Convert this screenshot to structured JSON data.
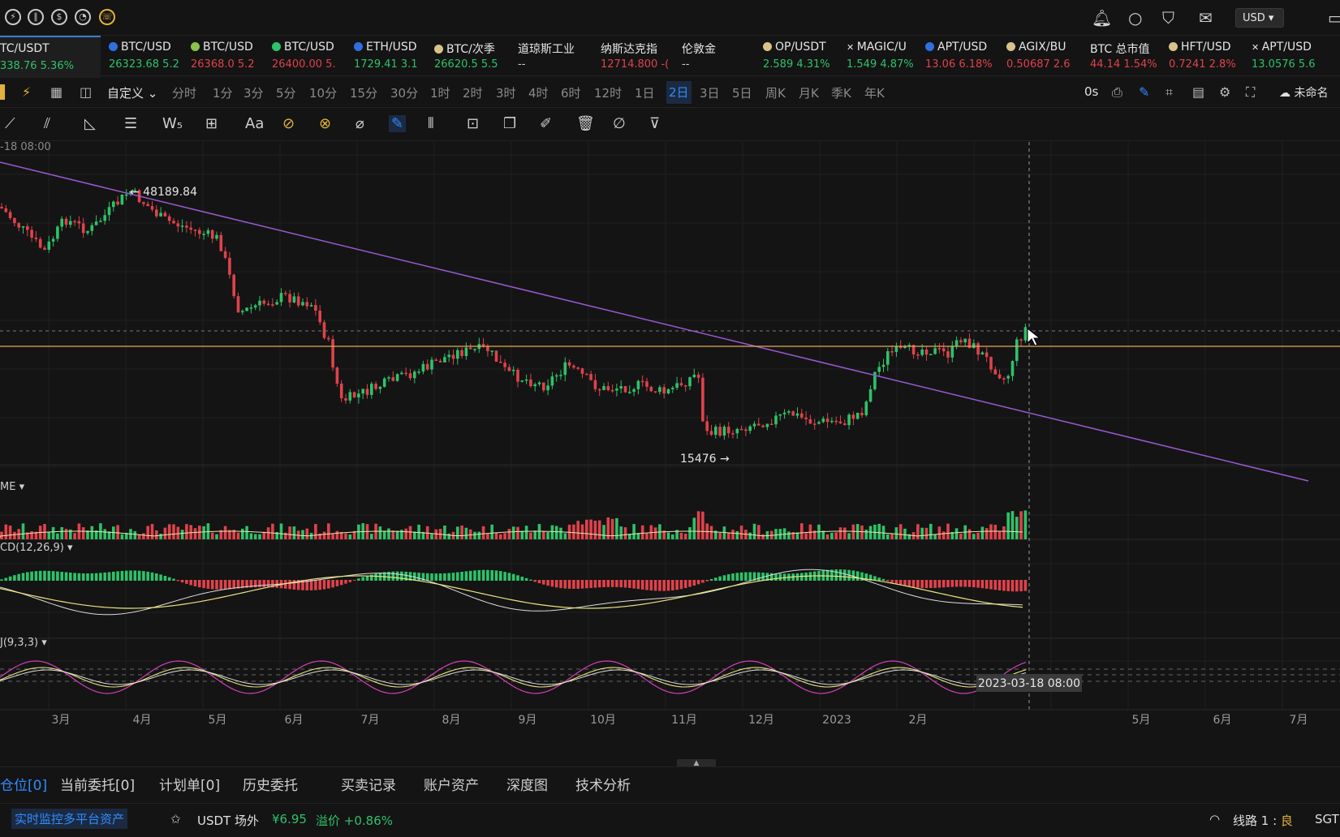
{
  "topbar": {
    "currency": "USD"
  },
  "tickers": [
    {
      "name": "TC/USDT",
      "value": "338.76",
      "change": "5.36%",
      "dot": "",
      "trend": "up",
      "active": true
    },
    {
      "name": "BTC/USD",
      "value": "26323.68",
      "change": "5.2",
      "dot": "#2f6fe0",
      "trend": "up"
    },
    {
      "name": "BTC/USD",
      "value": "26368.0",
      "change": "5.2",
      "dot": "#8bc34a",
      "trend": "dn"
    },
    {
      "name": "BTC/USD",
      "value": "26400.00",
      "change": "5.",
      "dot": "#2ec26a",
      "trend": "dn"
    },
    {
      "name": "ETH/USD",
      "value": "1729.41",
      "change": "3.1",
      "dot": "#2f6fe0",
      "trend": "up"
    },
    {
      "name": "BTC/次季",
      "value": "26620.5",
      "change": "5.5",
      "dot": "#d8c38a",
      "trend": "up"
    },
    {
      "name": "道琼斯工业",
      "value": "--",
      "change": "",
      "dot": "",
      "trend": "wt"
    },
    {
      "name": "纳斯达克指",
      "value": "12714.800",
      "change": "-(",
      "dot": "",
      "trend": "dn"
    },
    {
      "name": "伦敦金",
      "value": "--",
      "change": "",
      "dot": "",
      "trend": "wt"
    },
    {
      "name": "OP/USDT",
      "value": "2.589",
      "change": "4.31%",
      "dot": "#d8c38a",
      "trend": "up"
    },
    {
      "name": "MAGIC/U",
      "value": "1.549",
      "change": "4.87%",
      "dot": "",
      "trend": "up",
      "icon": "✕"
    },
    {
      "name": "APT/USD",
      "value": "13.06",
      "change": "6.18%",
      "dot": "#2f6fe0",
      "trend": "dn"
    },
    {
      "name": "AGIX/BU",
      "value": "0.50687",
      "change": "2.6",
      "dot": "#d8c38a",
      "trend": "dn"
    },
    {
      "name": "BTC 总市值",
      "value": "44.14",
      "change": "1.54%",
      "dot": "",
      "trend": "dn"
    },
    {
      "name": "HFT/USD",
      "value": "0.7241",
      "change": "2.8%",
      "dot": "#d8c38a",
      "trend": "dn"
    },
    {
      "name": "APT/USD",
      "value": "13.0576",
      "change": "5.6",
      "dot": "",
      "trend": "up",
      "icon": "✕"
    }
  ],
  "intervals": {
    "custom": "自定义",
    "items": [
      "分时",
      "1分",
      "3分",
      "5分",
      "10分",
      "15分",
      "30分",
      "1时",
      "2时",
      "3时",
      "4时",
      "6时",
      "12时",
      "1日",
      "2日",
      "3日",
      "5日",
      "周K",
      "月K",
      "季K",
      "年K"
    ],
    "selected": "2日",
    "countdown": "0s",
    "layout_name": "未命名"
  },
  "chart": {
    "crosshair_time_label": "-18 08:00",
    "high_label": "← 48189.84",
    "low_label": "15476 →",
    "volume_label": "ME",
    "macd_label": "CD(12,26,9)",
    "kdj_label": "J(9,3,3)",
    "x_axis": [
      "3月",
      "4月",
      "5月",
      "6月",
      "7月",
      "8月",
      "9月",
      "10月",
      "11月",
      "12月",
      "2023",
      "2月",
      "5月",
      "6月",
      "7月"
    ],
    "crosshair_date": "2023-03-18 08:00",
    "colors": {
      "up": "#2ec26a",
      "down": "#e0424b",
      "trendline": "#9b59d0",
      "hline": "#e5a65a"
    }
  },
  "bottom_tabs": {
    "items": [
      "仓位[0]",
      "当前委托[0]",
      "计划单[0]",
      "历史委托",
      "买卖记录",
      "账户资产",
      "深度图",
      "技术分析"
    ],
    "active": "仓位[0]"
  },
  "status": {
    "monitor": "实时监控多平台资产",
    "usdt_label": "USDT 场外",
    "usdt_price": "¥6.95",
    "premium": "溢价 +0.86%",
    "line_label": "线路 1 : ",
    "line_quality": "良",
    "tz": "SGT"
  }
}
